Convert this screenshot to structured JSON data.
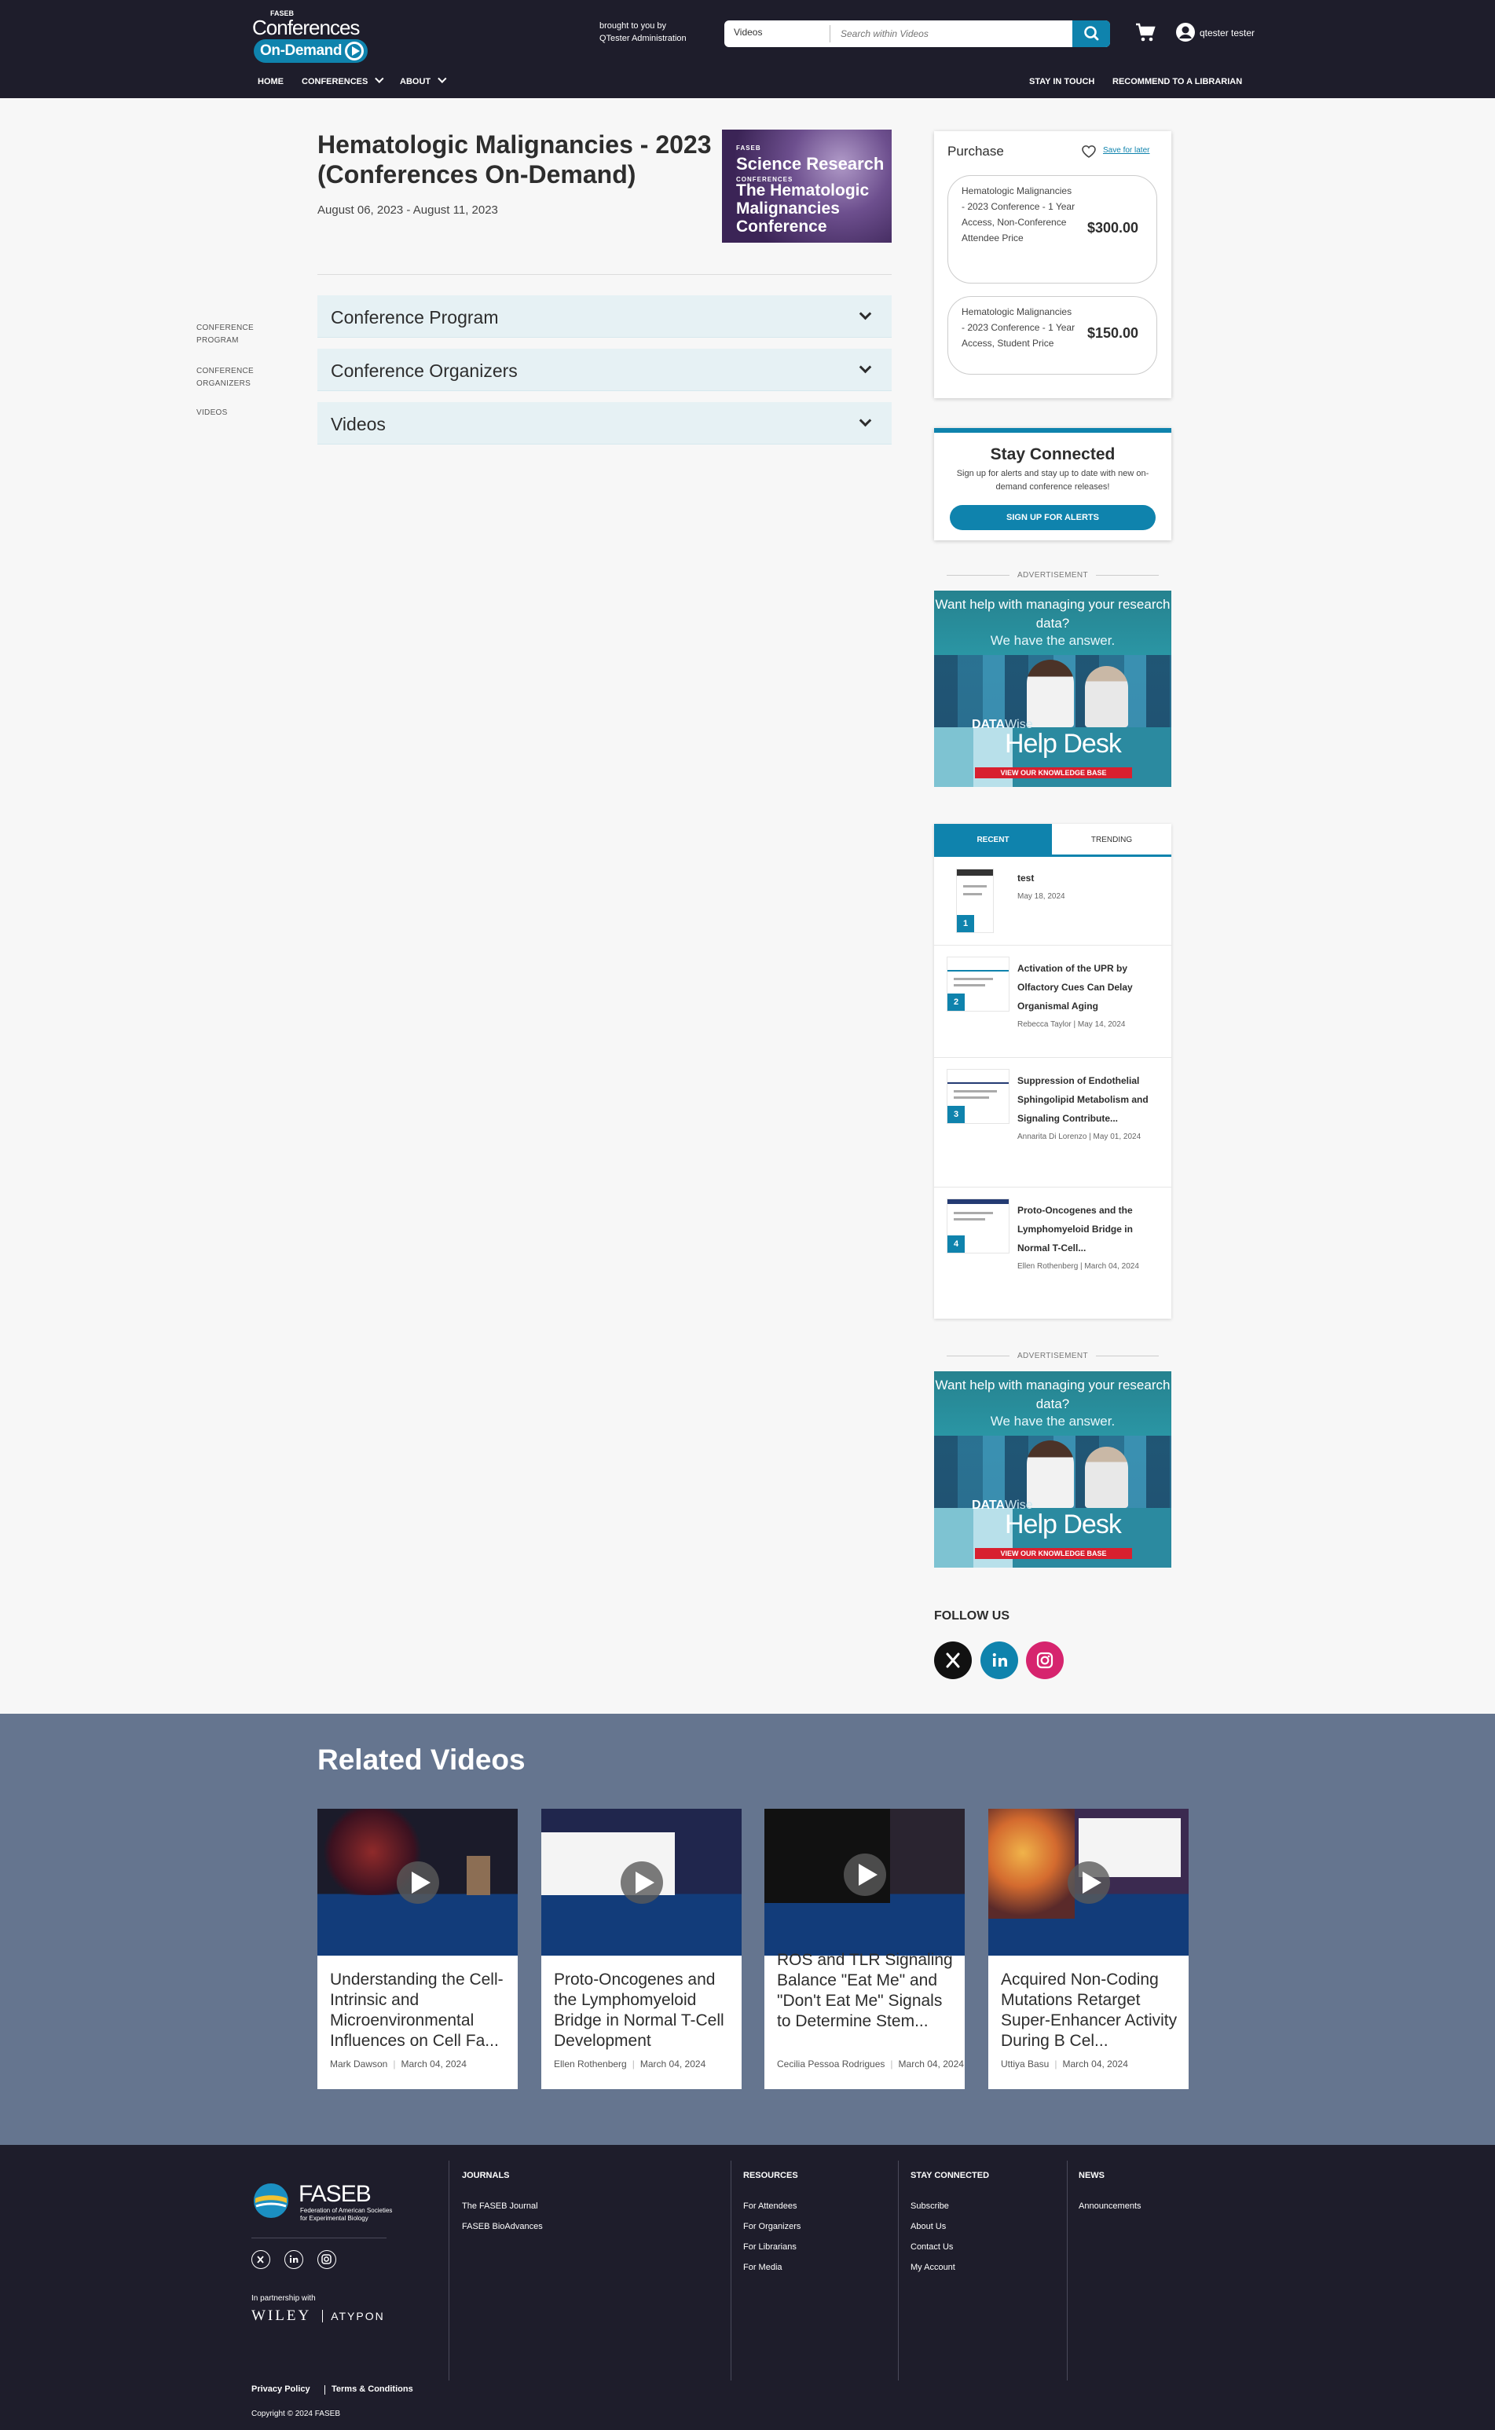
{
  "header": {
    "logo_small": "FASEB",
    "logo_main": "Conferences",
    "logo_pill": "On-Demand",
    "brought_line1": "brought to you by",
    "brought_line2": "QTester Administration",
    "search_scope": "Videos",
    "search_placeholder": "Search within Videos",
    "user_name": "qtester tester",
    "nav": [
      "HOME",
      "CONFERENCES",
      "ABOUT"
    ],
    "nav_right": [
      "STAY IN TOUCH",
      "RECOMMEND TO A LIBRARIAN"
    ]
  },
  "left_nav": [
    "CONFERENCE PROGRAM",
    "CONFERENCE ORGANIZERS",
    "VIDEOS"
  ],
  "main": {
    "title": "Hematologic Malignancies - 2023 (Conferences On-Demand)",
    "dates": "August 06, 2023  - August 11, 2023",
    "cover_brand_small": "FASEB",
    "cover_brand": "Science Research",
    "cover_brand_sub": "CONFERENCES",
    "cover_title": "The Hematologic Malignancies Conference",
    "accordions": [
      "Conference Program",
      "Conference Organizers",
      "Videos"
    ]
  },
  "purchase": {
    "title": "Purchase",
    "save_label": "Save for later",
    "options": [
      {
        "desc": "Hematologic Malignancies - 2023 Conference - 1 Year Access, Non-Conference Attendee Price",
        "price": "$300.00"
      },
      {
        "desc": "Hematologic Malignancies - 2023 Conference - 1 Year Access, Student Price",
        "price": "$150.00"
      }
    ]
  },
  "stay_connected": {
    "title": "Stay Connected",
    "text": "Sign up for alerts and stay up to date with new on-demand conference releases!",
    "button": "SIGN UP FOR ALERTS"
  },
  "ad": {
    "label": "ADVERTISEMENT",
    "question": "Want help with managing your research data?",
    "answer": "We have the answer.",
    "brand_a": "DATA",
    "brand_b": "Wise",
    "headline": "Help Desk",
    "cta": "VIEW OUR KNOWLEDGE BASE"
  },
  "sidebar_tabs": {
    "recent": "RECENT",
    "trending": "TRENDING",
    "items": [
      {
        "num": "1",
        "title": "test",
        "meta": "May 18, 2024"
      },
      {
        "num": "2",
        "title": "Activation of the UPR by Olfactory Cues Can Delay Organismal Aging",
        "meta": "Rebecca Taylor  |  May 14, 2024"
      },
      {
        "num": "3",
        "title": "Suppression of Endothelial Sphingolipid Metabolism and Signaling Contribute...",
        "meta": "Annarita Di Lorenzo  |  May 01, 2024"
      },
      {
        "num": "4",
        "title": "Proto-Oncogenes and the Lymphomyeloid Bridge in Normal T-Cell...",
        "meta": "Ellen Rothenberg  |  March 04, 2024"
      }
    ]
  },
  "follow": {
    "title": "FOLLOW US"
  },
  "related": {
    "title": "Related Videos",
    "videos": [
      {
        "title": "Understanding the Cell-Intrinsic and Microenvironmental Influences on Cell Fa...",
        "author": "Mark Dawson",
        "date": "March 04, 2024"
      },
      {
        "title": "Proto-Oncogenes and the Lymphomyeloid Bridge in Normal T-Cell Development",
        "author": "Ellen Rothenberg",
        "date": "March 04, 2024"
      },
      {
        "title": "ROS and TLR Signaling Balance \"Eat Me\" and \"Don't Eat Me\" Signals to Determine Stem...",
        "author": "Cecilia Pessoa Rodrigues",
        "date": "March 04, 2024"
      },
      {
        "title": "Acquired Non-Coding Mutations Retarget Super-Enhancer Activity During B Cel...",
        "author": "Uttiya Basu",
        "date": "March 04, 2024"
      }
    ]
  },
  "footer": {
    "brand": "FASEB",
    "brand_sub": "Federation of American Societies for Experimental Biology",
    "partner_label": "In partnership with",
    "partner_a": "WILEY",
    "partner_b": "ATYPON",
    "columns": [
      {
        "title": "JOURNALS",
        "links": [
          "The FASEB Journal",
          "FASEB BioAdvances"
        ]
      },
      {
        "title": "RESOURCES",
        "links": [
          "For Attendees",
          "For Organizers",
          "For Librarians",
          "For Media"
        ]
      },
      {
        "title": "STAY CONNECTED",
        "links": [
          "Subscribe",
          "About Us",
          "Contact Us",
          "My Account"
        ]
      },
      {
        "title": "NEWS",
        "links": [
          "Announcements"
        ]
      }
    ],
    "privacy": "Privacy Policy",
    "terms": "Terms & Conditions",
    "copyright": "Copyright © 2024 FASEB"
  },
  "colors": {
    "accent": "#0f83ad",
    "header_bg": "#1e1d2b",
    "related_bg": "#65758f"
  },
  "icons": [
    "search-icon",
    "cart-icon",
    "user-icon",
    "heart-icon",
    "x-icon",
    "linkedin-icon",
    "instagram-icon",
    "play-icon",
    "chevron-down-icon"
  ]
}
